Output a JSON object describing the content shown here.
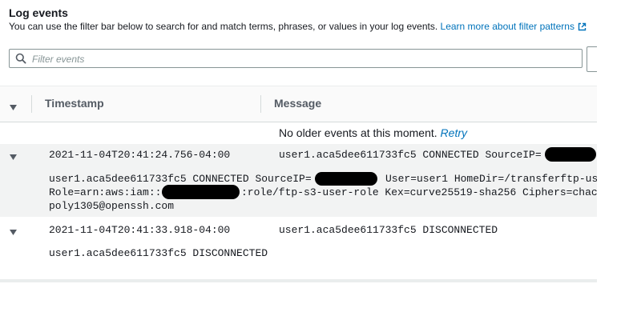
{
  "header": {
    "title": "Log events",
    "description": "You can use the filter bar below to search for and match terms, phrases, or values in your log events.",
    "learn_more": "Learn more about filter patterns"
  },
  "filter": {
    "placeholder": "Filter events"
  },
  "table": {
    "col_timestamp": "Timestamp",
    "col_message": "Message"
  },
  "status": {
    "no_older": "No older events at this moment.",
    "retry": "Retry"
  },
  "events": [
    {
      "timestamp": "2021-11-04T20:41:24.756-04:00",
      "message": "user1.aca5dee611733fc5 CONNECTED SourceIP=",
      "expanded": true,
      "detail_line1_a": "user1.aca5dee611733fc5 CONNECTED SourceIP=",
      "detail_line1_b": "User=user1 HomeDir=/transferftp-us",
      "detail_line2_a": "Role=arn:aws:iam::",
      "detail_line2_b": ":role/ftp-s3-user-role Kex=curve25519-sha256 Ciphers=chac",
      "detail_line3": "poly1305@openssh.com"
    },
    {
      "timestamp": "2021-11-04T20:41:33.918-04:00",
      "message": "user1.aca5dee611733fc5 DISCONNECTED",
      "expanded": true,
      "detail_line1_a": "user1.aca5dee611733fc5 DISCONNECTED"
    }
  ],
  "colors": {
    "link": "#0073bb",
    "expanded_row_bg": "#f2f3f3",
    "header_bg": "#fafafa"
  },
  "icons": {
    "external_link": "external-link-icon",
    "search": "search-icon",
    "caret": "caret-down-icon"
  }
}
